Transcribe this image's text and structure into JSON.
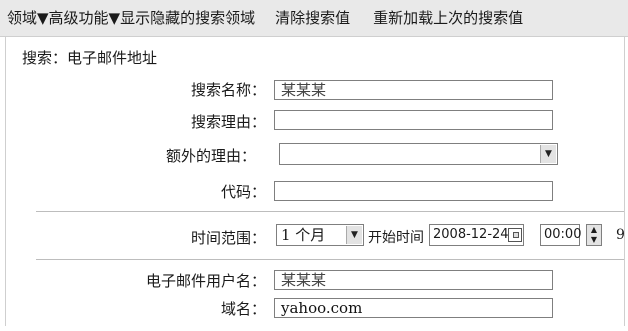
{
  "menu": {
    "domain": "领域▼",
    "advanced": "高级功能▼",
    "show_hidden": "显示隐藏的搜索领域",
    "clear": "清除搜索值",
    "reload": "重新加载上次的搜索值"
  },
  "section_title": "搜索：电子邮件地址",
  "form": {
    "search_name_label": "搜索名称：",
    "search_name_value": "某某某",
    "search_reason_label": "搜索理由：",
    "search_reason_value": "",
    "extra_reason_label": "额外的理由：",
    "extra_reason_value": "",
    "code_label": "代码：",
    "code_value": ""
  },
  "time": {
    "range_label": "时间范围：",
    "range_value": "1 个月",
    "start_label": "开始时间",
    "start_date": "2008-12-24",
    "start_time": "00:00",
    "cut_text": "9"
  },
  "email": {
    "user_label": "电子邮件用户名：",
    "user_value": "某某某",
    "domain_label": "域名：",
    "domain_value": "yahoo.com"
  },
  "icons": {
    "dropdown": "chevron-down-icon",
    "calendar": "calendar-icon",
    "spinner": "spinner-arrows-icon"
  }
}
